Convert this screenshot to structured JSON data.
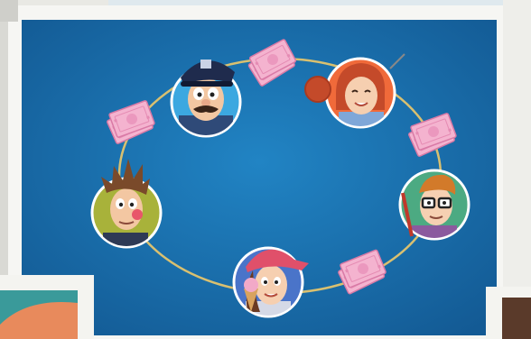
{
  "scene": {
    "description_free": true,
    "colors": {
      "board": "#1a6fb0",
      "board_dark": "#145e98",
      "ring": "#d9c070",
      "money": "#f2a9c8",
      "money_edge": "#e07fab",
      "frame": "#f6f6f3"
    }
  }
}
